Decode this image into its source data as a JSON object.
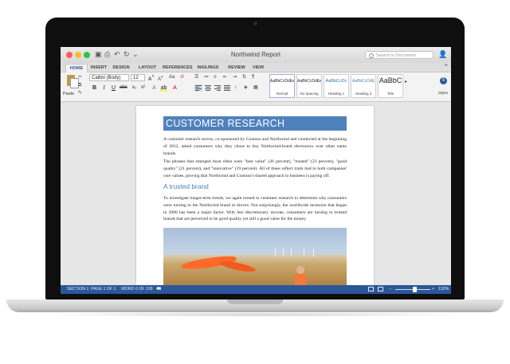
{
  "window": {
    "title": "Northwind Report",
    "search_placeholder": "Search in Document"
  },
  "tabs": [
    "HOME",
    "INSERT",
    "DESIGN",
    "LAYOUT",
    "REFERENCES",
    "MAILINGS",
    "REVIEW",
    "VIEW"
  ],
  "ribbon": {
    "paste_label": "Paste",
    "font_name": "Calibri (Body)",
    "font_size": "12",
    "styles": [
      {
        "sample": "AaBbCcDdEe",
        "name": "Normal"
      },
      {
        "sample": "AaBbCcDdEe",
        "name": "No Spacing"
      },
      {
        "sample": "AaBbCcDc",
        "name": "Heading 1"
      },
      {
        "sample": "AaBbCcDdE",
        "name": "Heading 2"
      },
      {
        "sample": "AaBbC",
        "name": "Title"
      }
    ],
    "styles_pane_label": "Styles"
  },
  "document": {
    "heading": "CUSTOMER RESEARCH",
    "paragraph_1": "A customer research survey, co-sponsored by Contoso and Northwind and conducted at the beginning of 2012, asked consumers why they chose to buy Northwind-brand electronics over other name brands.",
    "paragraph_2": "The phrases that emerged most often were \"best value\" (26 percent), \"trusted\" (23 percent), \"good quality\" (21 percent), and \"innovative\" (19 percent). All of these reflect traits tied to both companies' core values, proving that Northwind and Contoso's shared approach to business is paying off.",
    "subheading": "A trusted brand",
    "paragraph_3": "To investigate longer-term trends, we again turned to customer research to determine why consumers were turning to the Northwind brand in droves. Not surprisingly, the worldwide recession that began in 2008 has been a major factor. With less discretionary income, consumers are turning to trusted brands that are perceived to be good quality yet still a good value for the money."
  },
  "statusbar": {
    "section": "SECTION 1",
    "page": "PAGE 1 OF 1",
    "words": "WORD 0 OF 109",
    "zoom": "132%",
    "zoom_level": 0.55
  },
  "colors": {
    "accent": "#2b579a",
    "heading_band": "#4f81bd",
    "subheading": "#4f81bd"
  }
}
